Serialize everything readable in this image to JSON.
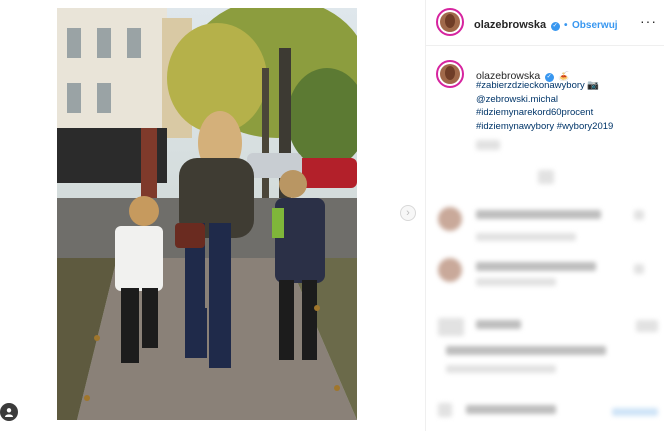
{
  "post": {
    "username": "olazebrowska",
    "follow_separator": "•",
    "follow_label": "Obserwuj",
    "more_options_label": "···",
    "caption_emoji": "🍝",
    "caption_lines": [
      "#zabierzdzieckonawybory 📷",
      "@zebrowski.michal",
      "#idziemynarekord60procent",
      "#idziemynawybory #wybory2019"
    ],
    "next_arrow_label": "›"
  },
  "colors": {
    "accent": "#3897f0",
    "hashtag": "#003569",
    "story_ring": "#d6249f"
  },
  "icons": [
    "verified-badge-icon",
    "chevron-right-icon",
    "user-icon",
    "more-options-icon"
  ]
}
